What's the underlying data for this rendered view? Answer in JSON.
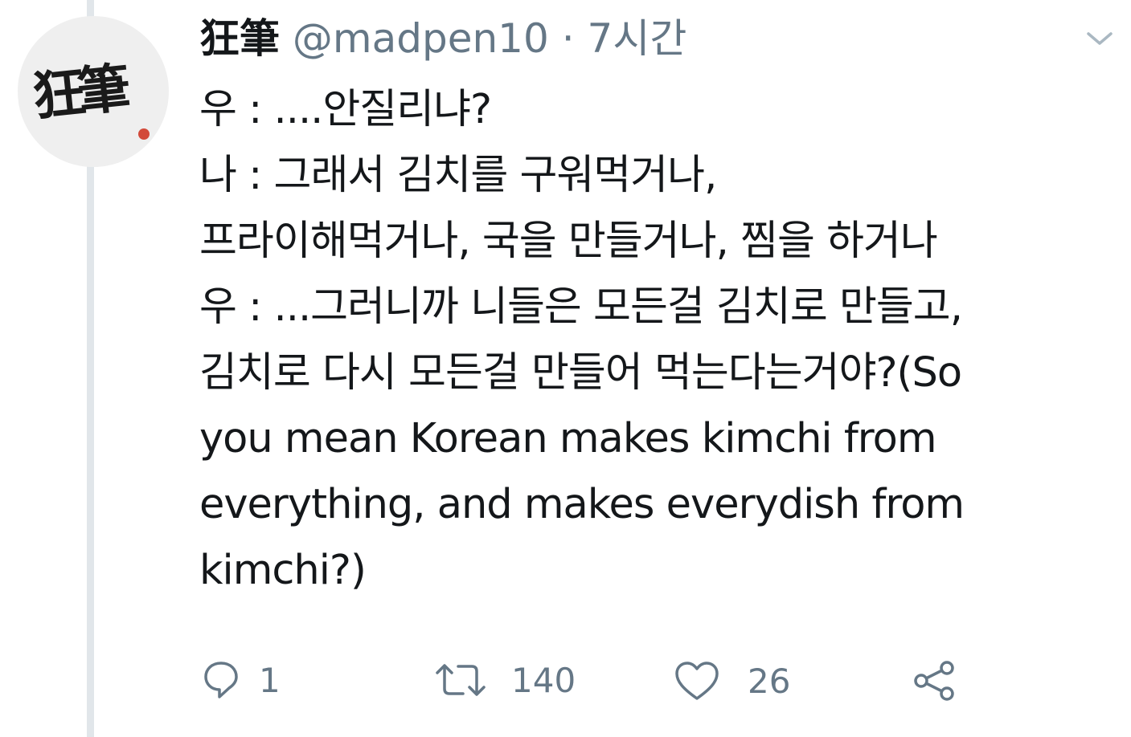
{
  "tweet": {
    "avatar_text": "狂筆",
    "display_name": "狂筆",
    "handle": "@madpen10",
    "separator": "·",
    "timestamp": "7시간",
    "lines": [
      "우 : ....안질리냐?",
      "나 : 그래서 김치를 구워먹거나,",
      "프라이해먹거나, 국을 만들거나, 찜을 하거나",
      "우 : ...그러니까 니들은 모든걸 김치로 만들고,",
      "김치로 다시 모든걸 만들어 먹는다는거야?(So",
      "you mean Korean makes kimchi from",
      "everything, and makes everydish from",
      "kimchi?)"
    ]
  },
  "actions": {
    "reply": {
      "icon": "reply-icon",
      "count": "1"
    },
    "retweet": {
      "icon": "retweet-icon",
      "count": "140"
    },
    "like": {
      "icon": "heart-icon",
      "count": "26"
    },
    "share": {
      "icon": "share-icon"
    }
  },
  "colors": {
    "text": "#14171a",
    "secondary": "#657786",
    "thread_line": "#e1e6ea",
    "avatar_bg": "#efefef",
    "avatar_accent": "#d24a3a"
  }
}
